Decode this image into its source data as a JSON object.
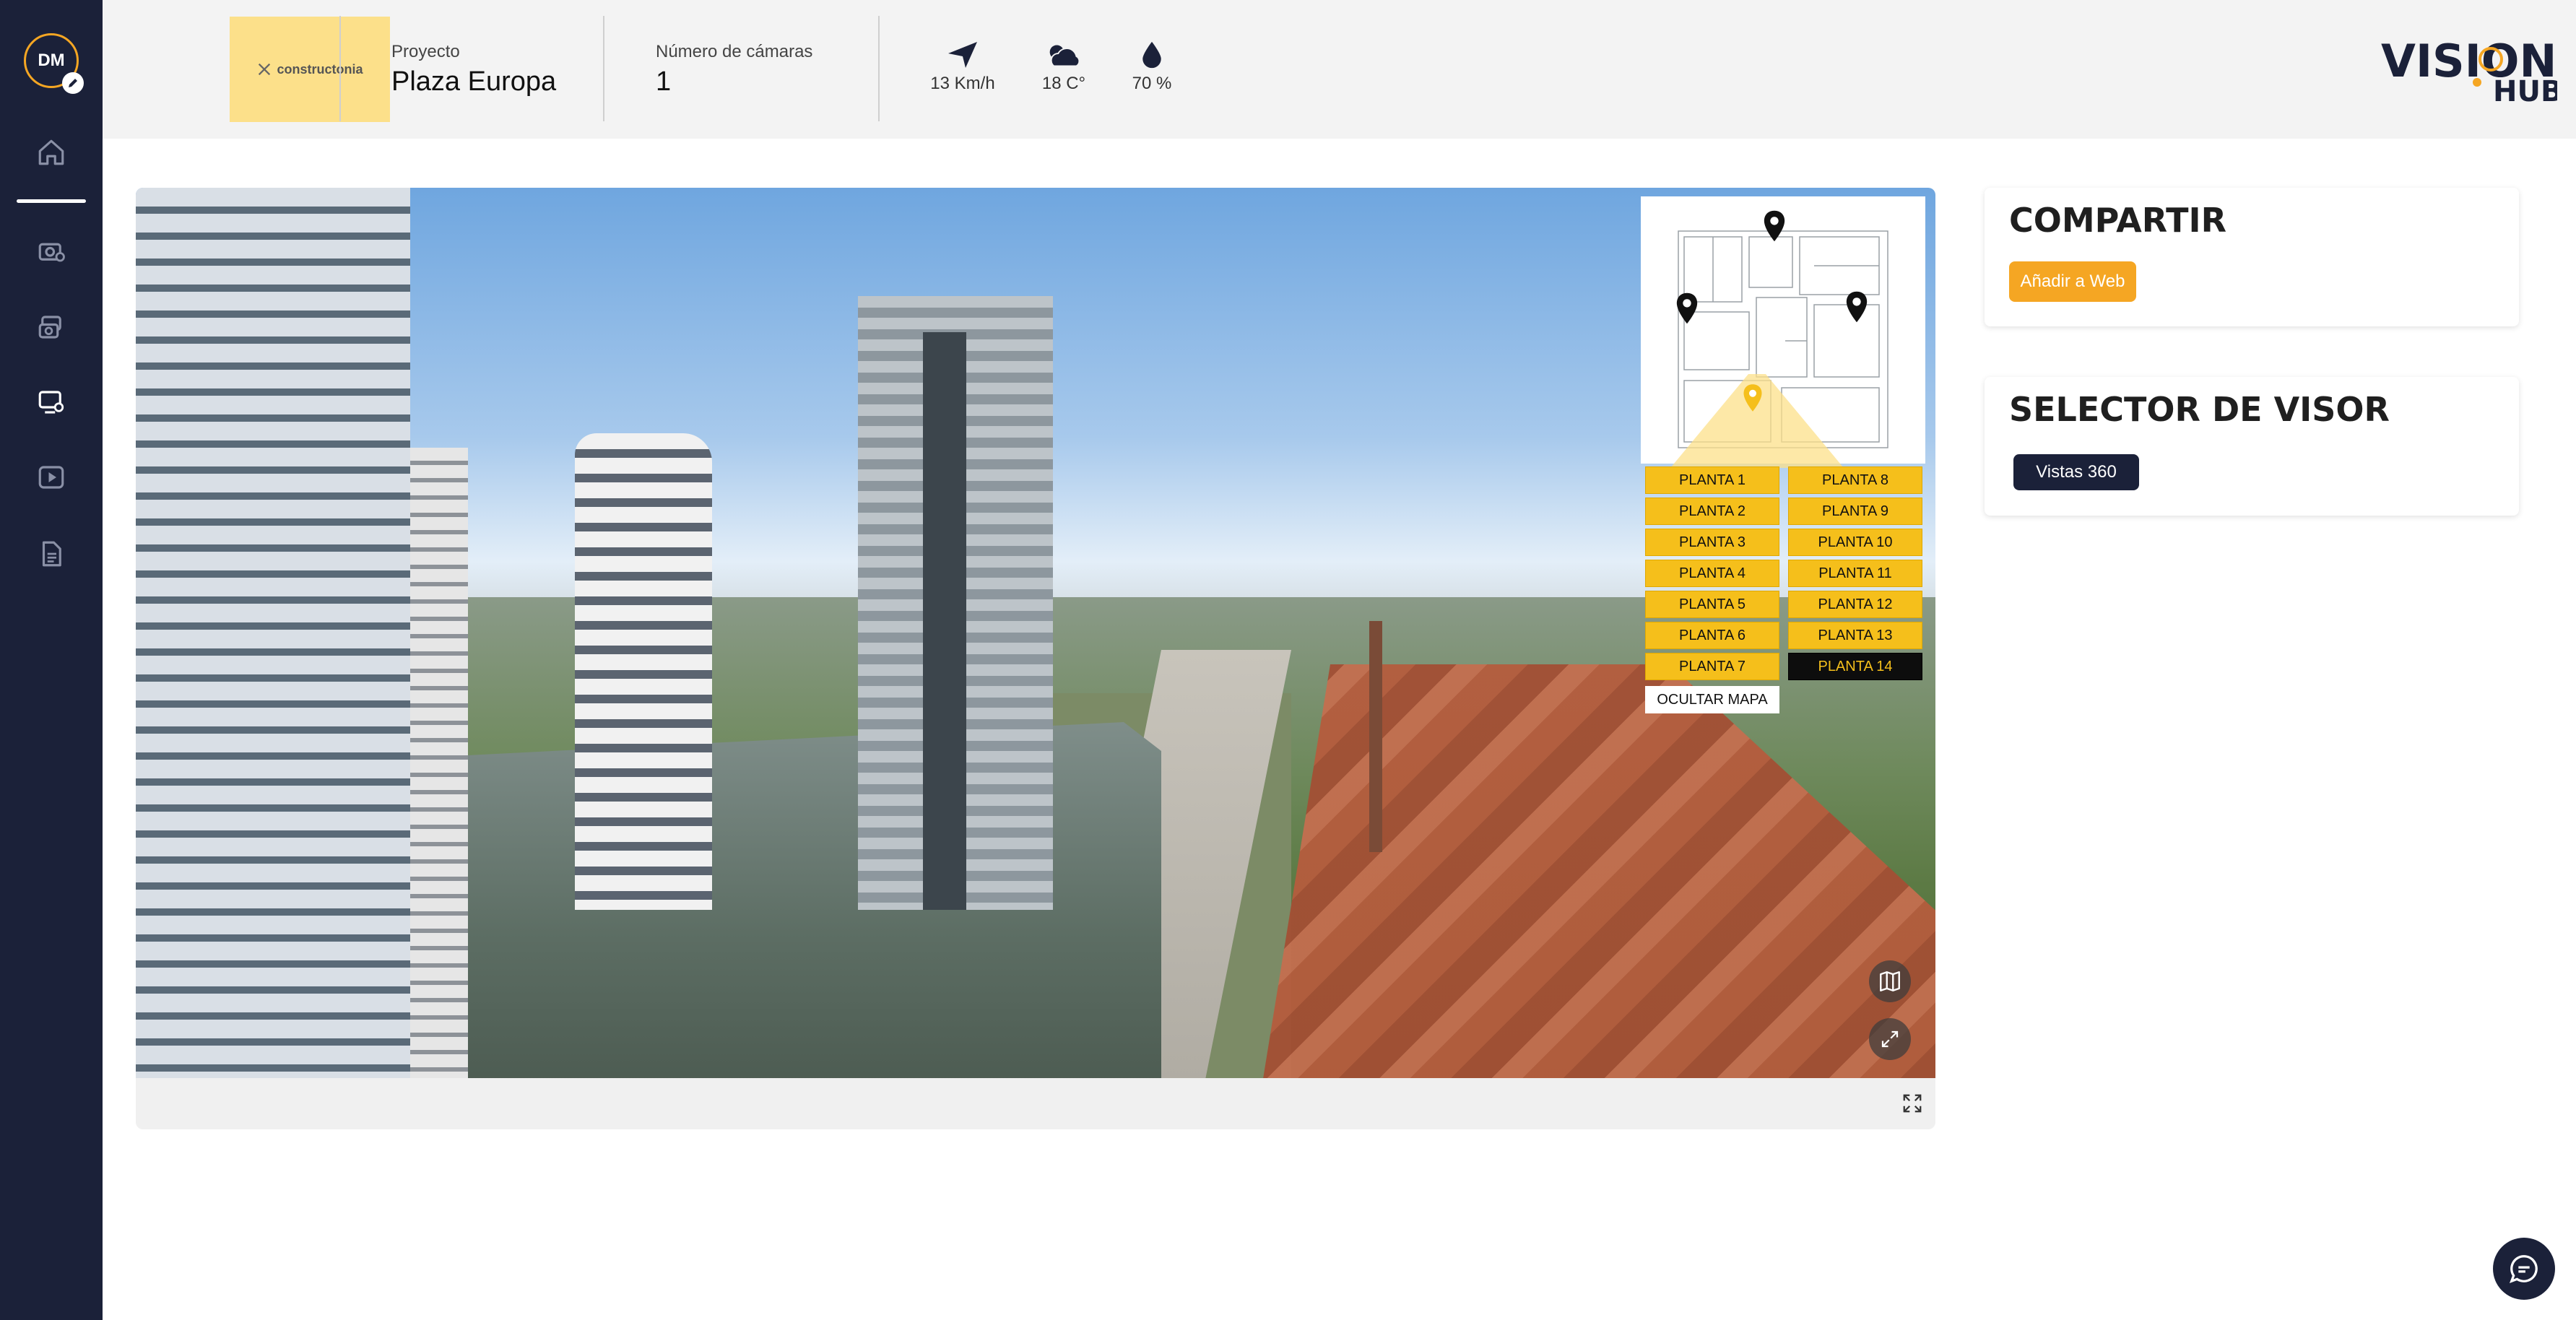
{
  "user": {
    "initials": "DM"
  },
  "sidebar": {
    "items": [
      {
        "icon": "home-icon"
      },
      {
        "icon": "camera-settings-icon"
      },
      {
        "icon": "cameras-icon"
      },
      {
        "icon": "video-monitor-icon"
      },
      {
        "icon": "play-video-icon"
      },
      {
        "icon": "document-icon"
      }
    ]
  },
  "header": {
    "client_logo": "constructonia",
    "project_label": "Proyecto",
    "project_value": "Plaza Europa",
    "cameras_label": "Número de cámaras",
    "cameras_value": "1",
    "wind": "13 Km/h",
    "temperature": "18 C°",
    "humidity": "70 %",
    "brand_top": "VISION",
    "brand_bottom": "HUB"
  },
  "viewer": {
    "floors_left": [
      "PLANTA 1",
      "PLANTA 2",
      "PLANTA 3",
      "PLANTA 4",
      "PLANTA 5",
      "PLANTA 6",
      "PLANTA 7"
    ],
    "floors_right": [
      "PLANTA 8",
      "PLANTA 9",
      "PLANTA 10",
      "PLANTA 11",
      "PLANTA 12",
      "PLANTA 13",
      "PLANTA 14"
    ],
    "active_floor": "PLANTA 14",
    "hide_map_label": "OCULTAR MAPA"
  },
  "share": {
    "title": "COMPARTIR",
    "button": "Añadir a Web"
  },
  "viewer_selector": {
    "title": "SELECTOR DE VISOR",
    "button": "Vistas 360"
  },
  "colors": {
    "sidebar": "#1b2139",
    "accent": "#f5a623",
    "floor": "#f5bf1b"
  }
}
